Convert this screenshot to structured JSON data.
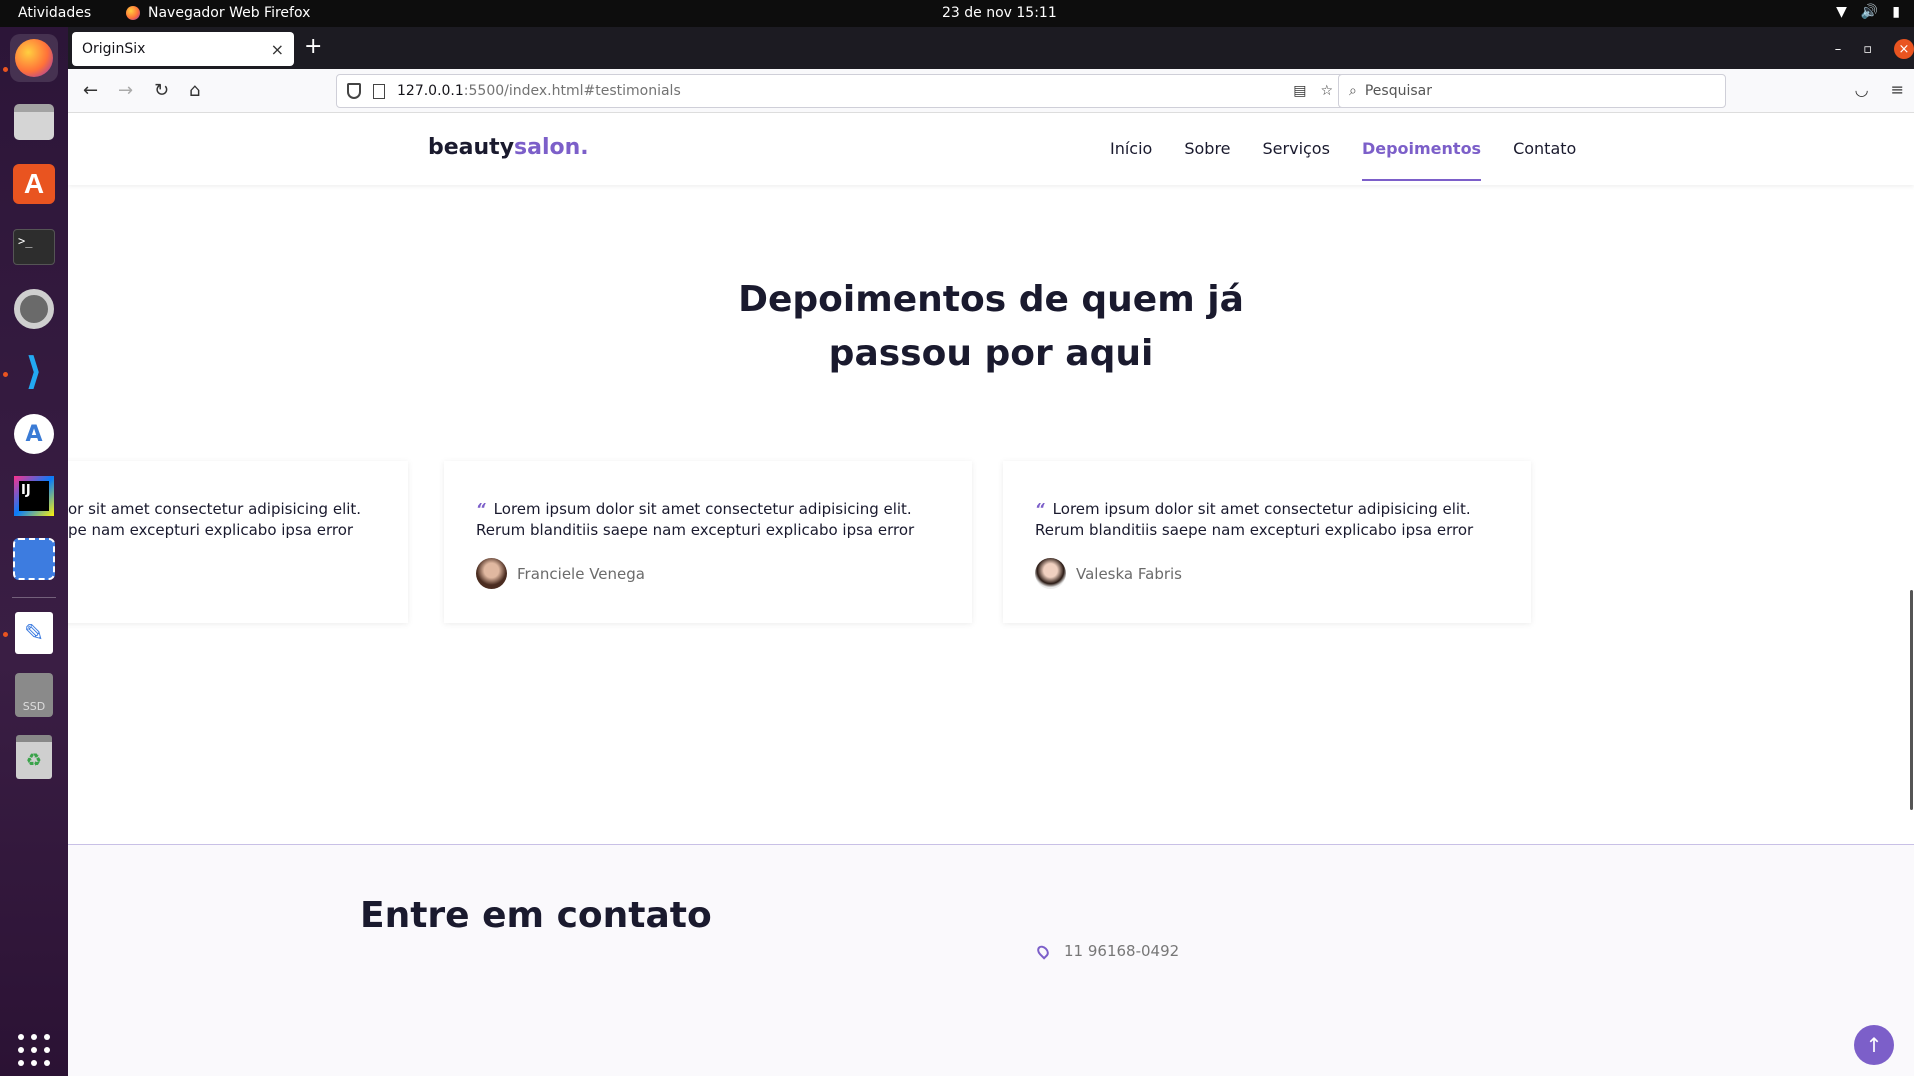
{
  "topbar": {
    "activities": "Atividades",
    "app_name": "Navegador Web Firefox",
    "clock": "23 de nov  15:11"
  },
  "browser": {
    "tab_title": "OriginSix",
    "url_host": "127.0.0.1",
    "url_path": ":5500/index.html#testimonials",
    "search_placeholder": "Pesquisar"
  },
  "site": {
    "logo_main": "beauty",
    "logo_accent": "salon.",
    "menu": [
      "Início",
      "Sobre",
      "Serviços",
      "Depoimentos",
      "Contato"
    ],
    "active_menu": "Depoimentos",
    "testimonials_title_line1": "Depoimentos de quem já",
    "testimonials_title_line2": "passou por aqui",
    "testimonials": [
      {
        "line1": "or sit amet consectetur adipisicing elit.",
        "line2": "pe nam excepturi explicabo ipsa error",
        "author": ""
      },
      {
        "line1": "Lorem ipsum dolor sit amet consectetur adipisicing elit.",
        "line2": "Rerum blanditiis saepe nam excepturi explicabo ipsa error",
        "author": "Franciele Venega"
      },
      {
        "line1": "Lorem ipsum dolor sit amet consectetur adipisicing elit.",
        "line2": "Rerum blanditiis saepe nam excepturi explicabo ipsa error",
        "author": "Valeska Fabris"
      }
    ],
    "quote_mark": "“",
    "contact_title": "Entre em contato",
    "contact_phone": "11 96168-0492"
  },
  "colors": {
    "accent": "#7c5fc9",
    "dark_text": "#1a1a2e",
    "ubuntu_orange": "#e95420"
  }
}
